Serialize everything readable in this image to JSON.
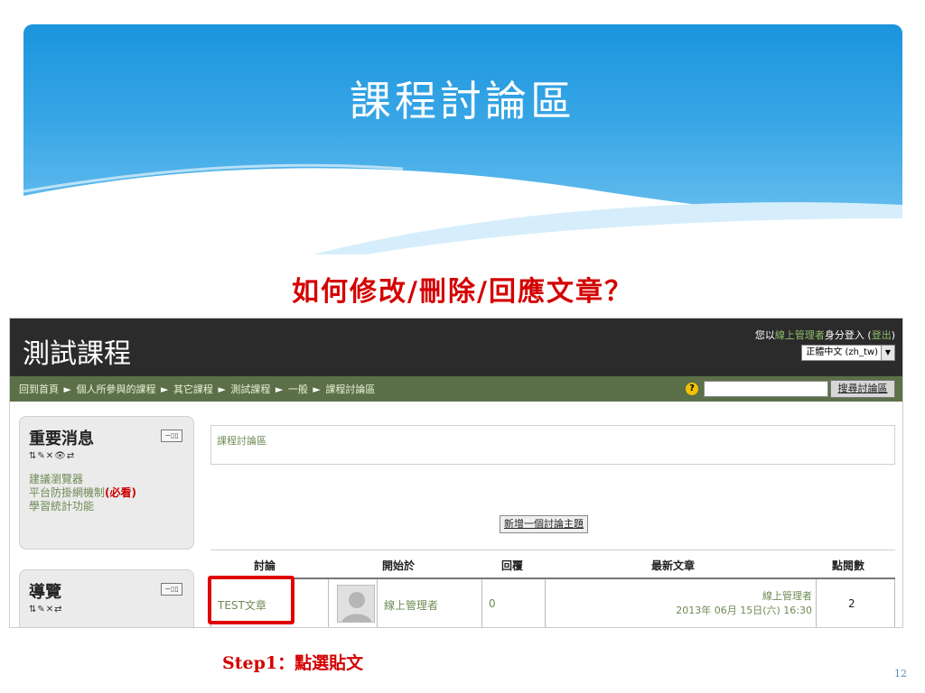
{
  "slide": {
    "title": "課程討論區",
    "subtitle": "如何修改/刪除/回應文章？",
    "step_label": "Step1：點選貼文",
    "page_number": "12"
  },
  "app": {
    "course_name": "測試課程",
    "login_prefix": "您以",
    "login_user": "線上管理者",
    "login_suffix": "身分登入 (",
    "logout": "登出",
    "login_close": ")",
    "language": "正體中文 (zh_tw)"
  },
  "breadcrumb": [
    "回到首頁",
    "個人所參與的課程",
    "其它課程",
    "測試課程",
    "一般",
    "課程討論區"
  ],
  "breadcrumb_sep": "►",
  "search": {
    "help": "?",
    "button": "搜尋討論區"
  },
  "blocks": {
    "news": {
      "title": "重要消息",
      "ctrl": "−▯▯",
      "icons": "⇅✎✕👁⇄",
      "links": [
        "建議瀏覽器",
        "平台防掛網機制",
        "學習統計功能"
      ],
      "links_red_suffix": "(必看)"
    },
    "nav": {
      "title": "導覽",
      "ctrl": "−▯▯",
      "icons": "⇅✎✕⇄"
    }
  },
  "main": {
    "intro": "課程討論區",
    "new_topic": "新增一個討論主題",
    "table": {
      "headers": [
        "討論",
        "開始於",
        "回覆",
        "最新文章",
        "點閱數"
      ],
      "row": {
        "topic": "TEST文章",
        "started_by": "線上管理者",
        "replies": "0",
        "last_author": "線上管理者",
        "last_date": "2013年 06月 15日(六) 16:30",
        "views": "2"
      }
    }
  },
  "colors": {
    "accent_red": "#d40000",
    "nav_green": "#5b7048",
    "link_green": "#6f8b55",
    "banner_blue": "#1a94dd"
  }
}
